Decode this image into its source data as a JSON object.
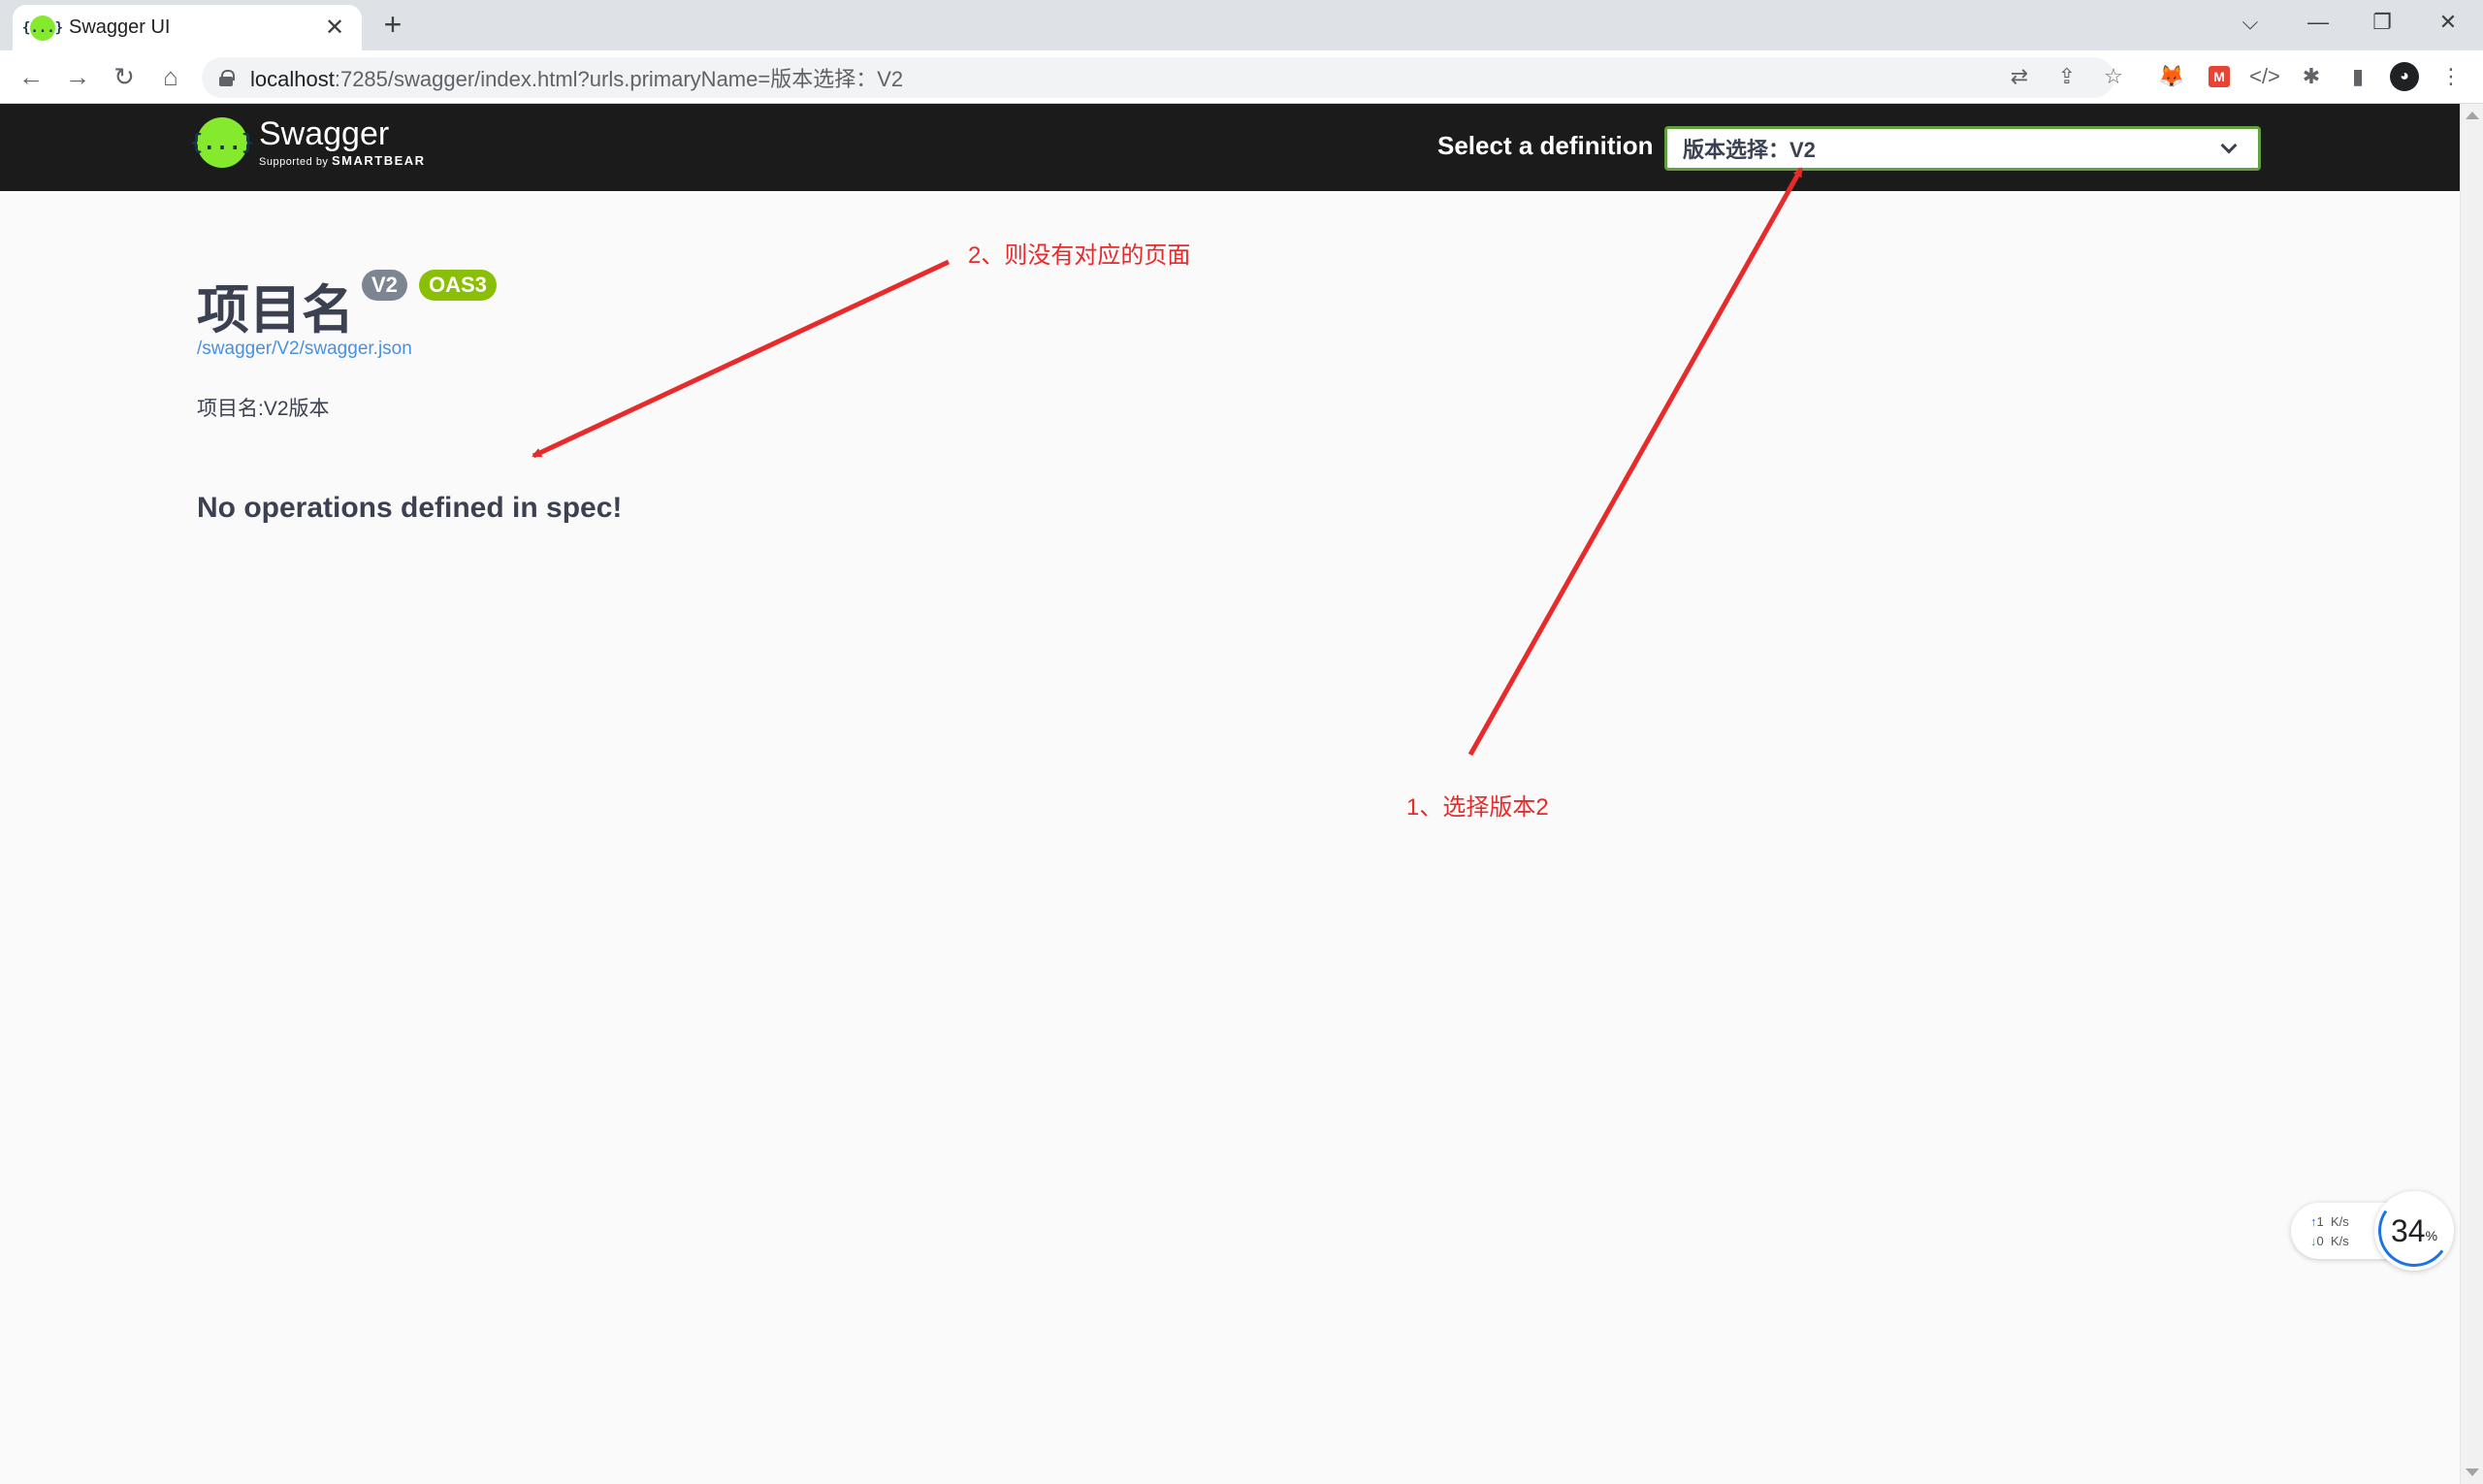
{
  "browser": {
    "tab_title": "Swagger UI",
    "tab_close_glyph": "✕",
    "new_tab_glyph": "+",
    "url_host": "localhost",
    "url_rest": ":7285/swagger/index.html?urls.primaryName=版本选择：V2",
    "nav": {
      "back": "←",
      "forward": "→",
      "reload": "↻",
      "home": "⌂"
    },
    "window": {
      "dropdown": "⌵",
      "minimize": "—",
      "restore": "❐",
      "close": "✕"
    },
    "toolbar_glyphs": {
      "translate": "⇄",
      "share": "⇪",
      "bookmark": "☆",
      "metamask": "🦊",
      "m_ext": "M",
      "devtools": "</>",
      "extensions": "✱",
      "sidepanel": "▮",
      "profile": "◕",
      "menu": "⋮"
    }
  },
  "swagger": {
    "logo_name": "Swagger",
    "logo_sub_prefix": "Supported by",
    "logo_sub_brand": "SMARTBEAR",
    "logo_glyph": "{...}",
    "definition_label": "Select a definition",
    "definition_value": "版本选择：V2",
    "title": "项目名",
    "version_badge": "V2",
    "oas_badge": "OAS3",
    "spec_link": "/swagger/V2/swagger.json",
    "description": "项目名:V2版本",
    "no_operations": "No operations defined in spec!"
  },
  "annotations": {
    "note_1": "1、选择版本2",
    "note_2": "2、则没有对应的页面",
    "color": "#e82a2a"
  },
  "net_widget": {
    "up_value": "1",
    "up_unit": "K/s",
    "down_value": "0",
    "down_unit": "K/s",
    "cpu_value": "34",
    "cpu_unit": "%"
  },
  "colors": {
    "swagger_green": "#85ea2d",
    "topbar_bg": "#1b1b1b",
    "select_border": "#62a03f",
    "oas_badge": "#89bf04",
    "version_badge": "#7d8492",
    "link": "#4990e2"
  }
}
